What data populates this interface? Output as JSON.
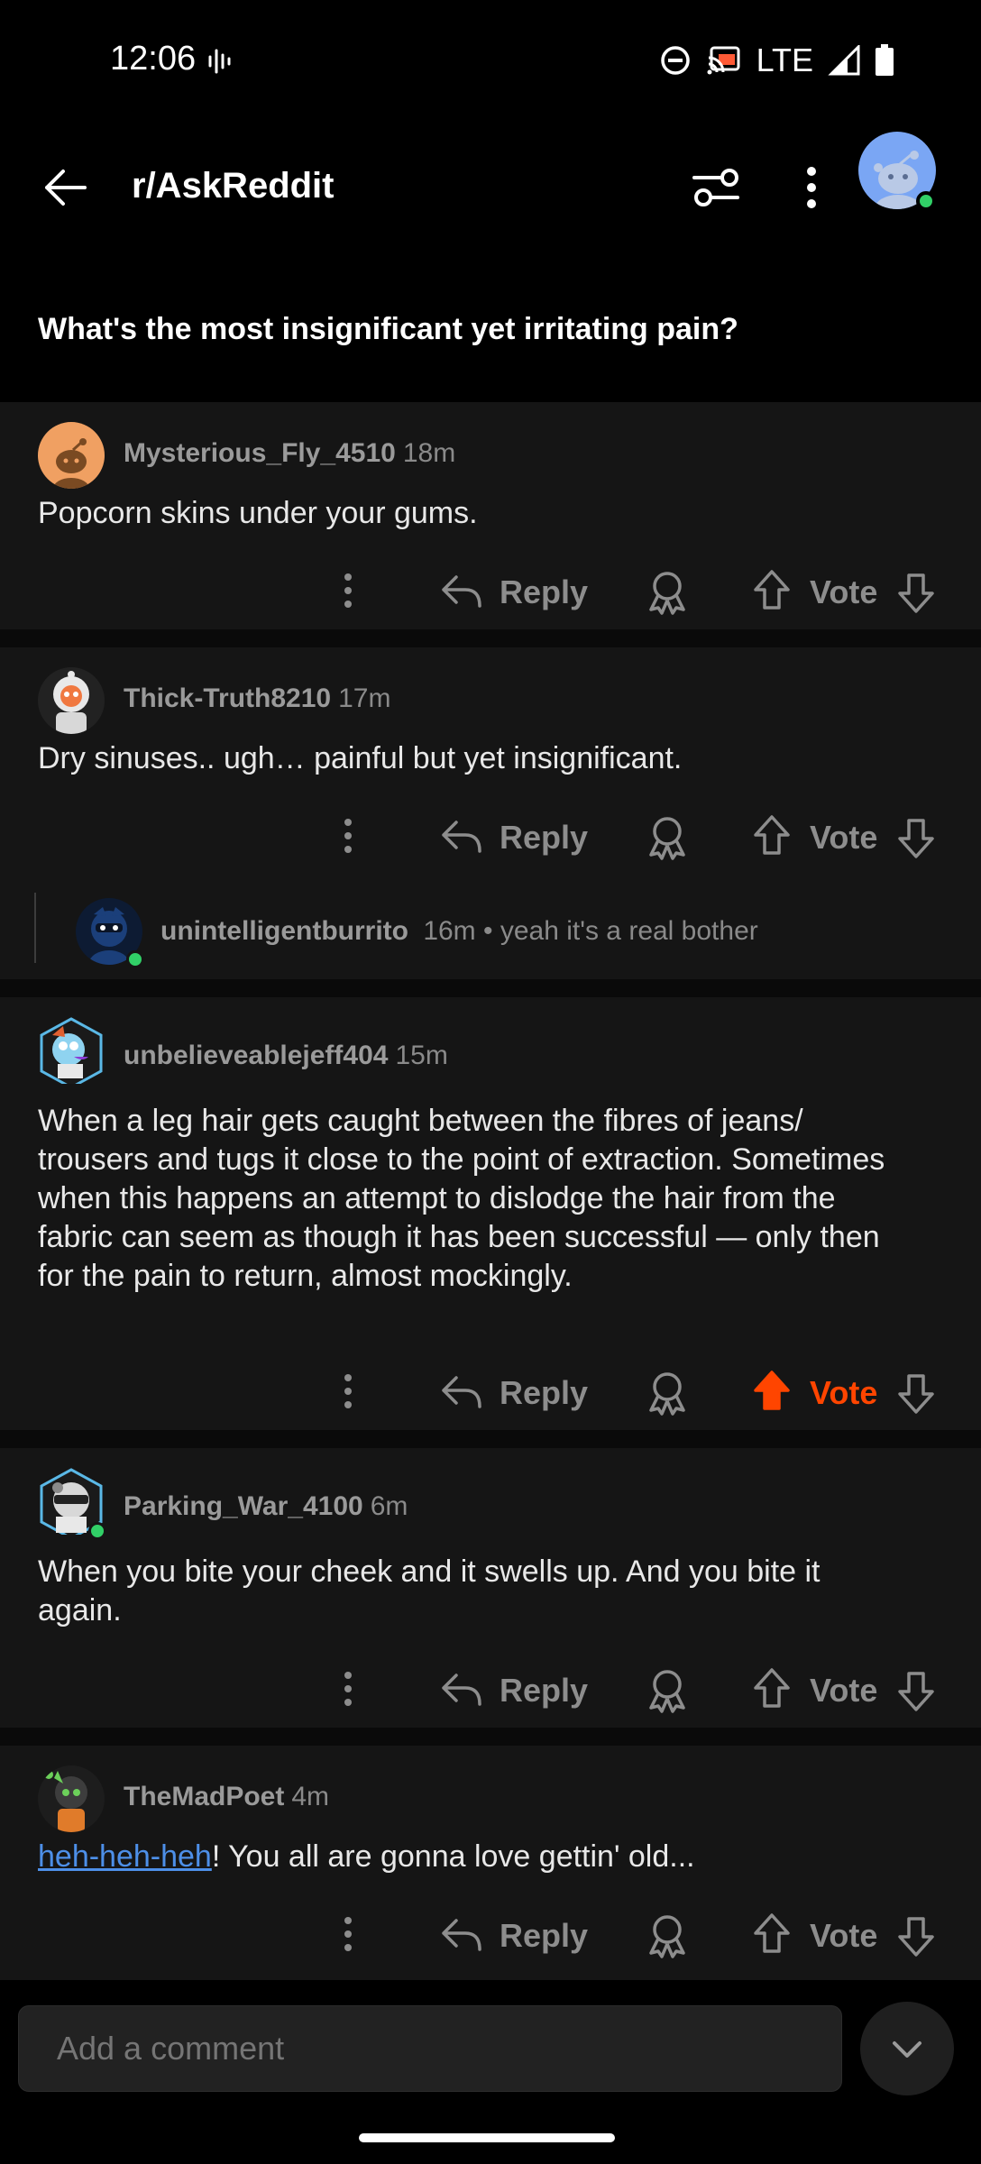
{
  "status": {
    "time": "12:06",
    "network": "LTE"
  },
  "appbar": {
    "subreddit": "r/AskReddit"
  },
  "post": {
    "title": "What's the most insignificant yet irritating pain?"
  },
  "actions": {
    "reply_label": "Reply",
    "vote_label": "Vote"
  },
  "comments": [
    {
      "user": "Mysterious_Fly_4510",
      "time": "18m",
      "body": "Popcorn skins under your gums.",
      "voted": false
    },
    {
      "user": "Thick-Truth8210",
      "time": "17m",
      "body": "Dry sinuses.. ugh… painful but yet insignificant.",
      "voted": false,
      "reply": {
        "user": "unintelligentburrito",
        "time": "16m",
        "snippet": "• yeah it's a real bother"
      }
    },
    {
      "user": "unbelieveablejeff404",
      "time": "15m",
      "body": "When a leg hair gets caught between the fibres of jeans/ trousers and tugs it close to the point of extraction. Sometimes when this happens an attempt to dislodge the hair from the fabric can seem as though it has been successful — only then for the pain to return, almost mockingly.",
      "voted": true
    },
    {
      "user": "Parking_War_4100",
      "time": "6m",
      "body": "When you bite your cheek and it swells up. And you bite it again.",
      "voted": false
    },
    {
      "user": "TheMadPoet",
      "time": "4m",
      "body_link": "heh-heh-heh",
      "body_rest": "! You all are gonna love gettin' old...",
      "voted": false
    }
  ],
  "composer": {
    "placeholder": "Add a comment"
  },
  "colors": {
    "accent_vote": "#ff4500",
    "link": "#4d8fe8",
    "online": "#31d067"
  }
}
